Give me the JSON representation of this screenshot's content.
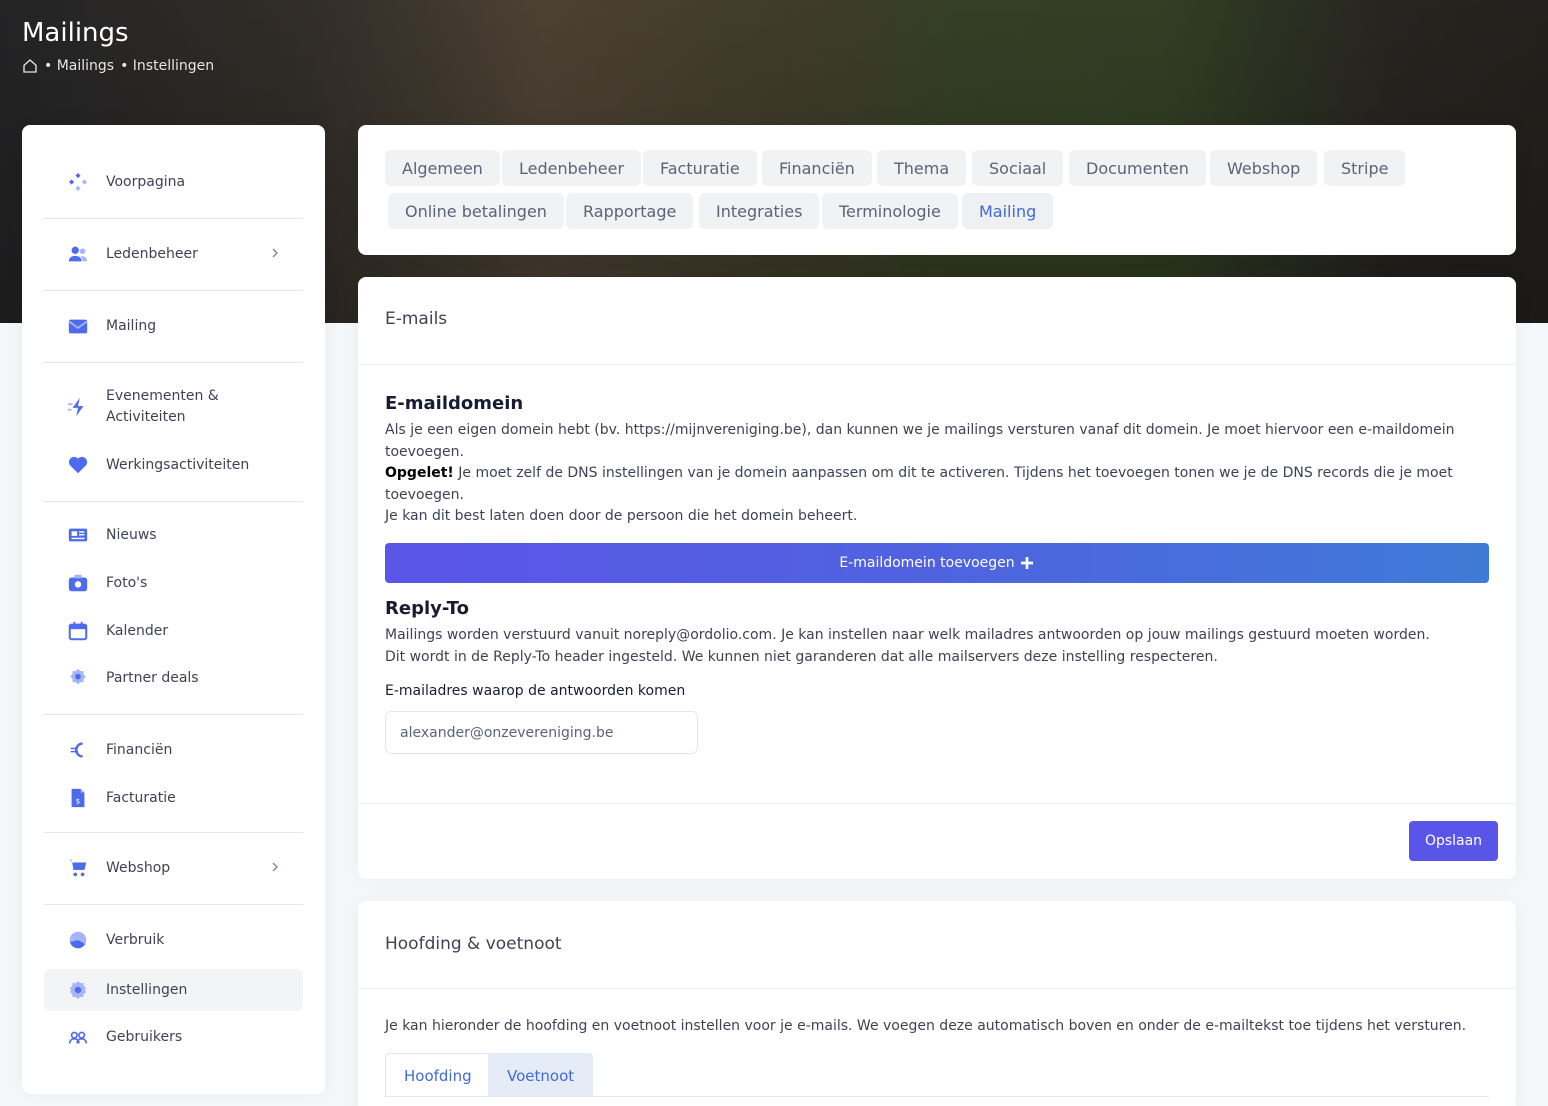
{
  "header": {
    "title": "Mailings",
    "breadcrumb": [
      "• Mailings",
      "• Instellingen"
    ]
  },
  "sidebar": {
    "items": [
      {
        "label": "Voorpagina",
        "icon": "diamond-icon"
      },
      {
        "label": "Ledenbeheer",
        "icon": "users-icon",
        "has_submenu": true
      },
      {
        "label": "Mailing",
        "icon": "mail-icon"
      },
      {
        "label": "Evenementen & Activiteiten",
        "icon": "lightning-icon"
      },
      {
        "label": "Werkingsactiviteiten",
        "icon": "heart-icon"
      },
      {
        "label": "Nieuws",
        "icon": "newspaper-icon"
      },
      {
        "label": "Foto's",
        "icon": "camera-icon"
      },
      {
        "label": "Kalender",
        "icon": "calendar-icon"
      },
      {
        "label": "Partner deals",
        "icon": "badge-icon"
      },
      {
        "label": "Financiën",
        "icon": "euro-icon"
      },
      {
        "label": "Facturatie",
        "icon": "invoice-icon"
      },
      {
        "label": "Webshop",
        "icon": "cart-icon",
        "has_submenu": true
      },
      {
        "label": "Verbruik",
        "icon": "pie-chart-icon"
      },
      {
        "label": "Instellingen",
        "icon": "gear-icon",
        "active": true
      },
      {
        "label": "Gebruikers",
        "icon": "user-group-icon"
      }
    ]
  },
  "tabs": [
    "Algemeen",
    "Ledenbeheer",
    "Facturatie",
    "Financiën",
    "Thema",
    "Sociaal",
    "Documenten",
    "Webshop",
    "Stripe",
    "Online betalingen",
    "Rapportage",
    "Integraties",
    "Terminologie",
    "Mailing"
  ],
  "active_tab": "Mailing",
  "emails": {
    "title": "E-mails",
    "domain_heading": "E-maildomein",
    "domain_text_1": "Als je een eigen domein hebt (bv. https://mijnvereniging.be), dan kunnen we je mailings versturen vanaf dit domein. Je moet hiervoor een e-maildomein toevoegen.",
    "domain_warning_bold": "Opgelet!",
    "domain_warning_text": " Je moet zelf de DNS instellingen van je domein aanpassen om dit te activeren. Tijdens het toevoegen tonen we je de DNS records die je moet toevoegen.",
    "domain_text_2": "Je kan dit best laten doen door de persoon die het domein beheert.",
    "add_domain_button": "E-maildomein toevoegen",
    "reply_heading": "Reply-To",
    "reply_text_1": "Mailings worden verstuurd vanuit noreply@ordolio.com. Je kan instellen naar welk mailadres antwoorden op jouw mailings gestuurd moeten worden.",
    "reply_text_2": "Dit wordt in de Reply-To header ingesteld. We kunnen niet garanderen dat alle mailservers deze instelling respecteren.",
    "reply_label": "E-mailadres waarop de antwoorden komen",
    "reply_value": "alexander@onzevereniging.be",
    "save_button": "Opslaan"
  },
  "header_footer": {
    "title": "Hoofding & voetnoot",
    "text": "Je kan hieronder de hoofding en voetnoot instellen voor je e-mails. We voegen deze automatisch boven en onder de e-mailtekst toe tijdens het versturen.",
    "tabs": [
      "Hoofding",
      "Voetnoot"
    ]
  },
  "colors": {
    "accent": "#5855e8",
    "link": "#3f6ad8",
    "icon": "#4f6bed"
  }
}
